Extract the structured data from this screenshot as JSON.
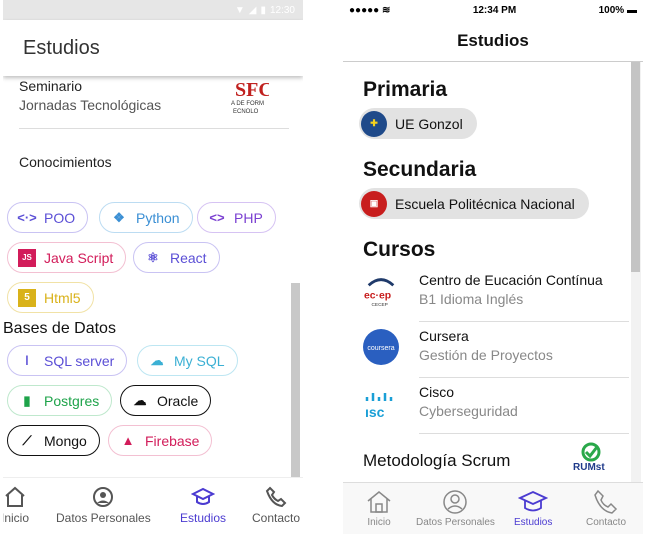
{
  "android": {
    "status_time": "12:30",
    "title": "Estudios",
    "seminar": {
      "type": "Seminario",
      "name": "Jornadas Tecnológicas",
      "logo_text": "SFC"
    },
    "knowledge_label": "Conocimientos",
    "languages": [
      {
        "label": "POO",
        "icon": "code-icon",
        "color": "#5b4fd6"
      },
      {
        "label": "Python",
        "icon": "python-icon",
        "color": "#3b8fd4"
      },
      {
        "label": "PHP",
        "icon": "code-icon",
        "color": "#7a3fd1"
      },
      {
        "label": "Java Script",
        "icon": "javascript-icon",
        "color": "#d21c5a"
      },
      {
        "label": "React",
        "icon": "react-icon",
        "color": "#5b4fd6"
      },
      {
        "label": "Html5",
        "icon": "html5-icon",
        "color": "#d9b21a"
      }
    ],
    "databases_label": "Bases de Datos",
    "databases": [
      {
        "label": "SQL server",
        "icon": "sql-server-icon",
        "color": "#5b4fd6"
      },
      {
        "label": "My SQL",
        "icon": "cloud-icon",
        "color": "#3bb0d4"
      },
      {
        "label": "Postgres",
        "icon": "bookmark-icon",
        "color": "#1ea34a"
      },
      {
        "label": "Oracle",
        "icon": "cloud-icon",
        "color": "#111111"
      },
      {
        "label": "Mongo",
        "icon": "chart-line-icon",
        "color": "#111111"
      },
      {
        "label": "Firebase",
        "icon": "firebase-icon",
        "color": "#d21c5a"
      }
    ],
    "nav": [
      {
        "label": "Inicio",
        "icon": "home-icon"
      },
      {
        "label": "Datos Personales",
        "icon": "user-icon"
      },
      {
        "label": "Estudios",
        "icon": "school-icon",
        "active": true
      },
      {
        "label": "Contacto",
        "icon": "phone-icon"
      }
    ]
  },
  "ios": {
    "status_time": "12:34 PM",
    "status_battery": "100%",
    "title": "Estudios",
    "primaria_label": "Primaria",
    "primaria_school": "UE Gonzol",
    "secundaria_label": "Secundaria",
    "secundaria_school": "Escuela Politécnica Nacional",
    "cursos_label": "Cursos",
    "courses": [
      {
        "name": "Centro de Eucación Contínua",
        "detail": "B1 Idioma Inglés",
        "logo_text": "ec·ep"
      },
      {
        "name": "Cursera",
        "detail": "Gestión de Proyectos",
        "logo_text": "coursera"
      },
      {
        "name": "Cisco",
        "detail": "Cyberseguridad",
        "logo_text": "ısc"
      }
    ],
    "scrum_label": "Metodología Scrum",
    "scrum_logo_text": "RUMst",
    "nav": [
      {
        "label": "Inicio",
        "icon": "home-icon"
      },
      {
        "label": "Datos Personales",
        "icon": "user-icon"
      },
      {
        "label": "Estudios",
        "icon": "school-icon",
        "active": true
      },
      {
        "label": "Contacto",
        "icon": "phone-icon"
      }
    ]
  }
}
